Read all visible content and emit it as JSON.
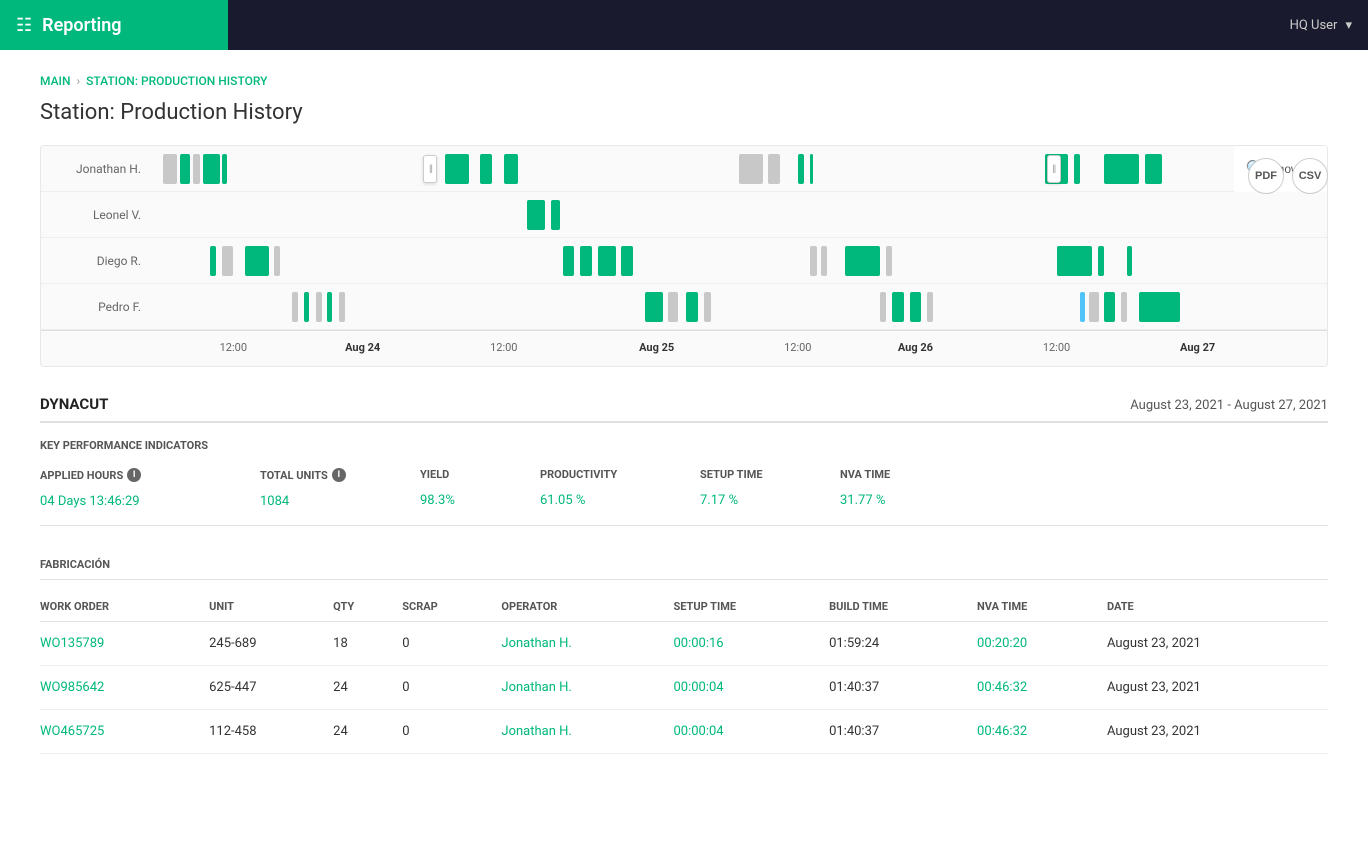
{
  "app": {
    "title": "Reporting",
    "user": "HQ User"
  },
  "breadcrumb": {
    "main": "MAIN",
    "separator": "›",
    "current": "STATION: PRODUCTION HISTORY"
  },
  "page": {
    "title": "Station: Production History"
  },
  "export": {
    "pdf_label": "PDF",
    "csv_label": "CSV"
  },
  "gantt": {
    "show_all": "Show all",
    "operators": [
      {
        "name": "Jonathan H."
      },
      {
        "name": "Leonel V."
      },
      {
        "name": "Diego R."
      },
      {
        "name": "Pedro F."
      }
    ],
    "axis_labels": [
      {
        "label": "12:00",
        "bold": false,
        "pct": 7
      },
      {
        "label": "Aug 24",
        "bold": true,
        "pct": 15
      },
      {
        "label": "12:00",
        "bold": false,
        "pct": 22
      },
      {
        "label": "Aug 25",
        "bold": true,
        "pct": 35
      },
      {
        "label": "12:00",
        "bold": false,
        "pct": 48
      },
      {
        "label": "Aug 26",
        "bold": true,
        "pct": 58
      },
      {
        "label": "12:00",
        "bold": false,
        "pct": 71
      },
      {
        "label": "Aug 27",
        "bold": true,
        "pct": 84
      }
    ]
  },
  "report": {
    "company": "DYNACUT",
    "date_range": "August 23, 2021 - August 27, 2021"
  },
  "kpi": {
    "section_label": "KEY PERFORMANCE INDICATORS",
    "columns": [
      {
        "header": "APPLIED HOURS",
        "has_info": true,
        "value": "04 Days 13:46:29"
      },
      {
        "header": "TOTAL UNITS",
        "has_info": true,
        "value": "1084"
      },
      {
        "header": "YIELD",
        "has_info": false,
        "value": "98.3%"
      },
      {
        "header": "PRODUCTIVITY",
        "has_info": false,
        "value": "61.05 %"
      },
      {
        "header": "SETUP TIME",
        "has_info": false,
        "value": "7.17 %"
      },
      {
        "header": "NVA TIME",
        "has_info": false,
        "value": "31.77 %"
      }
    ]
  },
  "fabricacion": {
    "label": "FABRICACIÓN",
    "columns": [
      "WORK ORDER",
      "UNIT",
      "QTY",
      "SCRAP",
      "OPERATOR",
      "SETUP TIME",
      "BUILD TIME",
      "NVA TIME",
      "DATE"
    ],
    "rows": [
      {
        "work_order": "WO135789",
        "unit": "245-689",
        "qty": "18",
        "scrap": "0",
        "operator": "Jonathan H.",
        "setup_time": "00:00:16",
        "build_time": "01:59:24",
        "nva_time": "00:20:20",
        "date": "August 23, 2021"
      },
      {
        "work_order": "WO985642",
        "unit": "625-447",
        "qty": "24",
        "scrap": "0",
        "operator": "Jonathan H.",
        "setup_time": "00:00:04",
        "build_time": "01:40:37",
        "nva_time": "00:46:32",
        "date": "August 23, 2021"
      },
      {
        "work_order": "WO465725",
        "unit": "112-458",
        "qty": "24",
        "scrap": "0",
        "operator": "Jonathan H.",
        "setup_time": "00:00:04",
        "build_time": "01:40:37",
        "nva_time": "00:46:32",
        "date": "August 23, 2021"
      }
    ]
  }
}
